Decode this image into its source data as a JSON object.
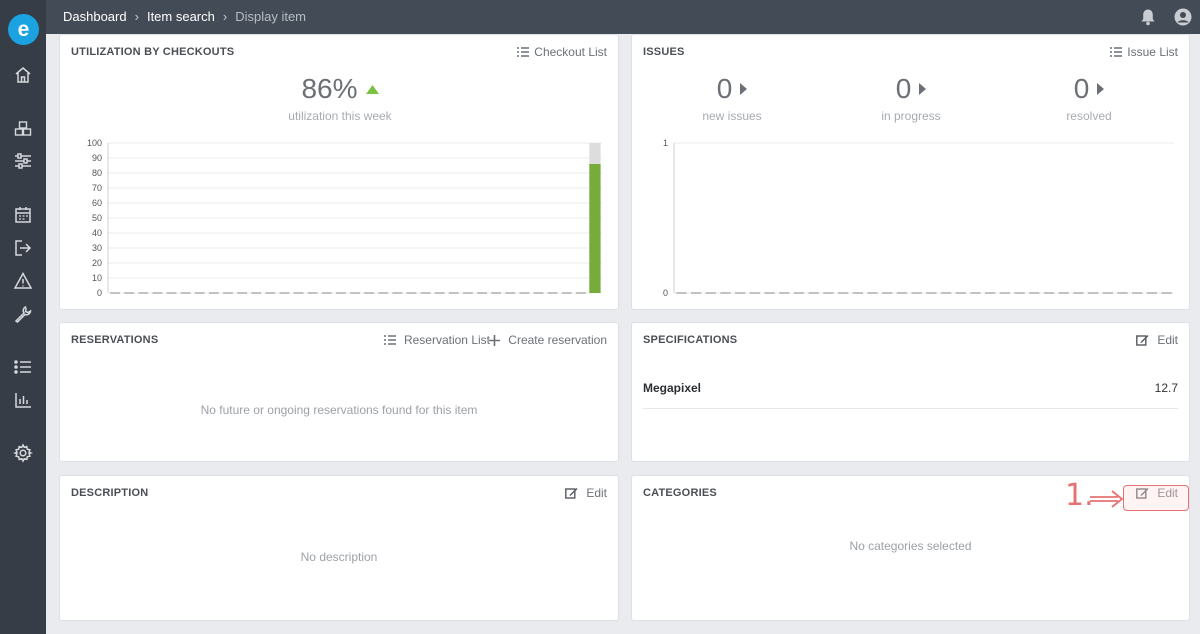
{
  "app": {
    "logo_letter": "e"
  },
  "breadcrumb": [
    "Dashboard",
    "Item search",
    "Display item"
  ],
  "sidebar_icons": [
    "home-icon",
    "boxes-icon",
    "sliders-icon",
    "calendar-icon",
    "checkout-icon",
    "warning-icon",
    "wrench-icon",
    "list-icon",
    "report-chart-icon",
    "gear-icon"
  ],
  "utilization": {
    "title": "UTILIZATION BY CHECKOUTS",
    "action": "Checkout List",
    "value": "86%",
    "sub": "utilization this week",
    "trend_color": "#7cc242"
  },
  "issues": {
    "title": "ISSUES",
    "action": "Issue List",
    "stats": [
      {
        "value": "0",
        "label": "new issues"
      },
      {
        "value": "0",
        "label": "in progress"
      },
      {
        "value": "0",
        "label": "resolved"
      }
    ]
  },
  "reservations": {
    "title": "RESERVATIONS",
    "action_list": "Reservation List",
    "action_create": "Create reservation",
    "empty": "No future or ongoing reservations found for this item"
  },
  "specifications": {
    "title": "SPECIFICATIONS",
    "action": "Edit",
    "rows": [
      {
        "key": "Megapixel",
        "value": "12.7"
      }
    ]
  },
  "description": {
    "title": "DESCRIPTION",
    "action": "Edit",
    "empty": "No description"
  },
  "categories": {
    "title": "CATEGORIES",
    "action": "Edit",
    "empty": "No categories selected"
  },
  "annotation": {
    "label": "1.",
    "color": "#e57373"
  },
  "chart_data": [
    {
      "type": "bar",
      "title": "",
      "ylim": [
        0,
        100
      ],
      "yticks": [
        0,
        10,
        20,
        30,
        40,
        50,
        60,
        70,
        80,
        90,
        100
      ],
      "grid": true,
      "bar_color": "#77ac3c",
      "remainder_color": "#dddddd",
      "series": [
        {
          "values": [
            0,
            0,
            0,
            0,
            0,
            0,
            0,
            0,
            0,
            0,
            0,
            0,
            0,
            0,
            0,
            0,
            0,
            0,
            0,
            0,
            0,
            0,
            0,
            0,
            0,
            0,
            0,
            0,
            0,
            0,
            0,
            0,
            0,
            0,
            86
          ]
        }
      ]
    },
    {
      "type": "bar",
      "title": "",
      "ylim": [
        0,
        1
      ],
      "yticks": [
        0,
        1
      ],
      "grid": true,
      "series": [
        {
          "values": [
            0,
            0,
            0,
            0,
            0,
            0,
            0,
            0,
            0,
            0,
            0,
            0,
            0,
            0,
            0,
            0,
            0,
            0,
            0,
            0,
            0,
            0,
            0,
            0,
            0,
            0,
            0,
            0,
            0,
            0,
            0,
            0,
            0,
            0
          ]
        }
      ]
    }
  ]
}
